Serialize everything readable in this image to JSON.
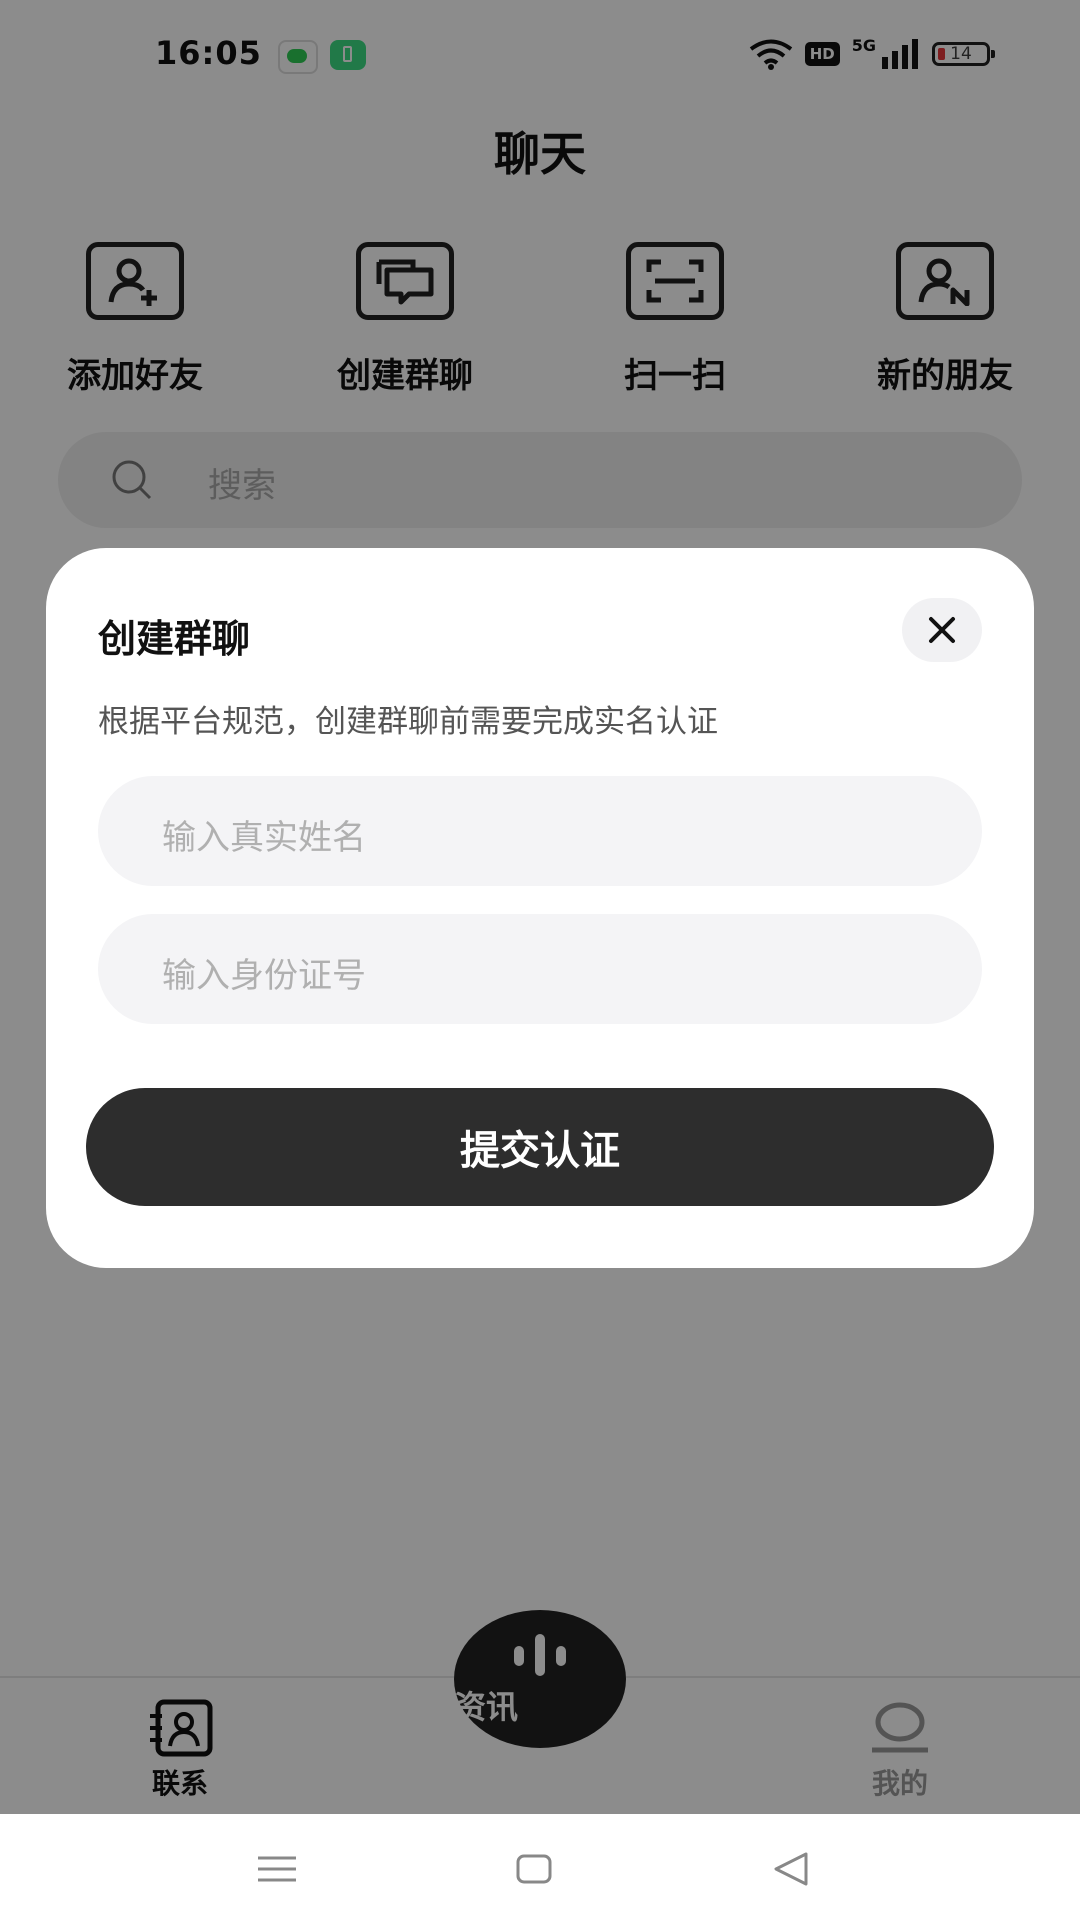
{
  "status_bar": {
    "time": "16:05",
    "network": "5G",
    "hd": "HD",
    "battery": "14"
  },
  "header": {
    "title": "聊天"
  },
  "quick_actions": [
    {
      "label": "添加好友",
      "icon": "add-user-icon"
    },
    {
      "label": "创建群聊",
      "icon": "group-chat-icon"
    },
    {
      "label": "扫一扫",
      "icon": "scan-icon"
    },
    {
      "label": "新的朋友",
      "icon": "new-friend-icon"
    }
  ],
  "search": {
    "placeholder": "搜索"
  },
  "dialog": {
    "title": "创建群聊",
    "description": "根据平台规范，创建群聊前需要完成实名认证",
    "name_placeholder": "输入真实姓名",
    "id_placeholder": "输入身份证号",
    "submit_label": "提交认证"
  },
  "tab_bar": {
    "contacts": "联系",
    "news": "资讯",
    "mine": "我的"
  },
  "colors": {
    "primary": "#2d2d2d",
    "overlay": "rgba(0,0,0,0.45)"
  }
}
